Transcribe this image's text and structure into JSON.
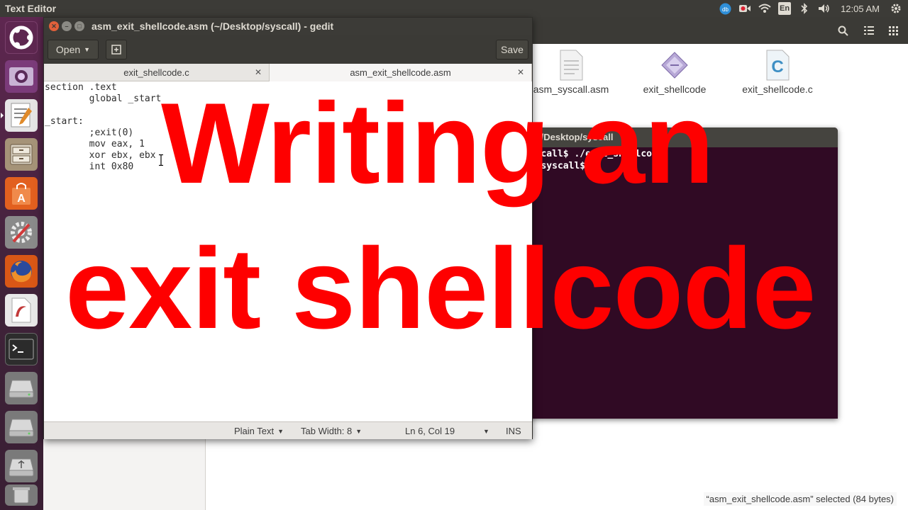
{
  "top_panel": {
    "app_title": "Text Editor",
    "input_method": "En",
    "clock": "12:05 AM"
  },
  "launcher": {
    "items": [
      "ubuntu-dash",
      "screenshot-app",
      "text-editor",
      "files",
      "software-center",
      "system-settings",
      "firefox",
      "libreoffice-draw",
      "terminal",
      "disk-drive-1",
      "disk-drive-2",
      "usb-drive",
      "trash"
    ]
  },
  "file_manager": {
    "files": [
      {
        "name": "asm_syscall.asm",
        "icon": "text-file-icon"
      },
      {
        "name": "exit_shellcode",
        "icon": "executable-icon"
      },
      {
        "name": "exit_shellcode.c",
        "icon": "c-source-icon"
      }
    ],
    "status": "“asm_exit_shellcode.asm” selected  (84 bytes)"
  },
  "terminal": {
    "title": "~/Desktop/syscall",
    "lines": [
      "syscall$ ./exit_shellcode",
      "op/syscall$ "
    ]
  },
  "gedit": {
    "title": "asm_exit_shellcode.asm (~/Desktop/syscall) - gedit",
    "open_label": "Open",
    "save_label": "Save",
    "tabs": [
      {
        "label": "exit_shellcode.c"
      },
      {
        "label": "asm_exit_shellcode.asm"
      }
    ],
    "code": "section .text\n\tglobal _start\n\n_start:\n\t;exit(0)\n\tmov eax, 1\n\txor ebx, ebx\n\tint 0x80",
    "status": {
      "language": "Plain Text",
      "tab_width": "Tab Width: 8",
      "position": "Ln 6, Col 19",
      "mode": "INS"
    }
  },
  "overlay": {
    "line1": "Writing an",
    "line2": "exit shellcode",
    "color": "#fe0000"
  }
}
